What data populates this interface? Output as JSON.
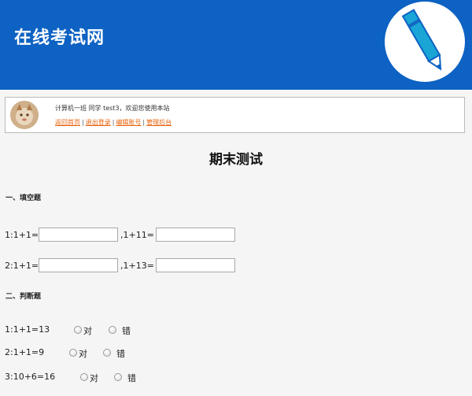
{
  "site": {
    "title": "在线考试网"
  },
  "user": {
    "welcome": "计算机一班 同学 test3，欢迎您使用本站",
    "links": [
      "返回首页",
      "退出登录",
      "编辑账号",
      "管理后台"
    ],
    "separator": "|"
  },
  "exam": {
    "title": "期末测试",
    "fill_section": "一、填空题",
    "fill_questions": [
      {
        "prefix": "1:1+1=",
        "middle": ",1+11=",
        "value1": "",
        "value2": ""
      },
      {
        "prefix": "2:1+1=",
        "middle": ",1+13=",
        "value1": "",
        "value2": ""
      }
    ],
    "judge_section": "二、判断题",
    "judge_questions": [
      {
        "text": "1:1+1=13",
        "true_label": "对",
        "false_label": "错"
      },
      {
        "text": "2:1+1=9",
        "true_label": "对",
        "false_label": "错"
      },
      {
        "text": "3:10+6=16",
        "true_label": "对",
        "false_label": "错"
      }
    ]
  },
  "icons": {
    "logo": "pencil-icon",
    "avatar": "avatar-image"
  },
  "colors": {
    "header": "#0d62c3",
    "link": "#e8610b",
    "logo_pencil": "#1aa5d6"
  }
}
